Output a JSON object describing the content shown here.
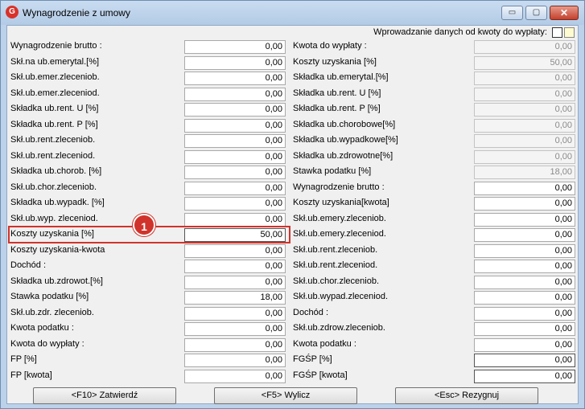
{
  "window": {
    "title": "Wynagrodzenie z umowy",
    "app_icon_letter": "G",
    "min_glyph": "▭",
    "max_glyph": "▢",
    "close_glyph": "✕"
  },
  "mode_label": "Wprowadzanie danych od kwoty do wypłaty:",
  "left_rows": [
    {
      "label": "Wynagrodzenie brutto :",
      "value": "0,00"
    },
    {
      "label": "Skł.na ub.emerytal.[%]",
      "value": "0,00"
    },
    {
      "label": "Skł.ub.emer.zleceniob.",
      "value": "0,00"
    },
    {
      "label": "Skł.ub.emer.zleceniod.",
      "value": "0,00"
    },
    {
      "label": "Składka ub.rent. U [%]",
      "value": "0,00"
    },
    {
      "label": "Składka ub.rent. P [%]",
      "value": "0,00"
    },
    {
      "label": "Skł.ub.rent.zleceniob.",
      "value": "0,00"
    },
    {
      "label": "Skł.ub.rent.zleceniod.",
      "value": "0,00"
    },
    {
      "label": "Składka ub.chorob. [%]",
      "value": "0,00"
    },
    {
      "label": "Skł.ub.chor.zleceniob.",
      "value": "0,00"
    },
    {
      "label": "Składka ub.wypadk. [%]",
      "value": "0,00"
    },
    {
      "label": "Skł.ub.wyp. zleceniod.",
      "value": "0,00"
    },
    {
      "label": "Koszty uzyskania [%]",
      "value": "50,00"
    },
    {
      "label": "Koszty uzyskania-kwota",
      "value": "0,00"
    },
    {
      "label": "Dochód :",
      "value": "0,00"
    },
    {
      "label": "Składka ub.zdrowot.[%]",
      "value": "0,00"
    },
    {
      "label": "Stawka podatku [%]",
      "value": "18,00"
    },
    {
      "label": "Skł.ub.zdr. zleceniob.",
      "value": "0,00"
    },
    {
      "label": "Kwota podatku :",
      "value": "0,00"
    },
    {
      "label": "Kwota do wypłaty :",
      "value": "0,00"
    },
    {
      "label": "FP [%]",
      "value": "0,00"
    },
    {
      "label": "FP [kwota]",
      "value": "0,00"
    }
  ],
  "right_rows": [
    {
      "label": "Kwota do wypłaty :",
      "value": "0,00"
    },
    {
      "label": "Koszty uzyskania [%]",
      "value": "50,00"
    },
    {
      "label": "Składka ub.emerytal.[%]",
      "value": "0,00"
    },
    {
      "label": "Składka ub.rent. U [%]",
      "value": "0,00"
    },
    {
      "label": "Składka ub.rent. P [%]",
      "value": "0,00"
    },
    {
      "label": "Składka ub.chorobowe[%]",
      "value": "0,00"
    },
    {
      "label": "Składka ub.wypadkowe[%]",
      "value": "0,00"
    },
    {
      "label": "Składka ub.zdrowotne[%]",
      "value": "0,00"
    },
    {
      "label": "Stawka podatku [%]",
      "value": "18,00"
    },
    {
      "label": "Wynagrodzenie brutto :",
      "value": "0,00"
    },
    {
      "label": "Koszty uzyskania[kwota]",
      "value": "0,00"
    },
    {
      "label": "Skł.ub.emery.zleceniob.",
      "value": "0,00"
    },
    {
      "label": "Skł.ub.emery.zleceniod.",
      "value": "0,00"
    },
    {
      "label": "Skł.ub.rent.zleceniob.",
      "value": "0,00"
    },
    {
      "label": "Skł.ub.rent.zleceniod.",
      "value": "0,00"
    },
    {
      "label": "Skł.ub.chor.zleceniob.",
      "value": "0,00"
    },
    {
      "label": "Skł.ub.wypad.zleceniod.",
      "value": "0,00"
    },
    {
      "label": "Dochód :",
      "value": "0,00"
    },
    {
      "label": "Skł.ub.zdrow.zleceniob.",
      "value": "0,00"
    },
    {
      "label": "Kwota podatku :",
      "value": "0,00"
    },
    {
      "label": "FGŚP [%]",
      "value": "0,00"
    },
    {
      "label": "FGŚP [kwota]",
      "value": "0,00"
    }
  ],
  "annotation_badge": "1",
  "buttons": {
    "confirm": "<F10> Zatwierdź",
    "calculate": "<F5> Wylicz",
    "cancel": "<Esc> Rezygnuj"
  }
}
